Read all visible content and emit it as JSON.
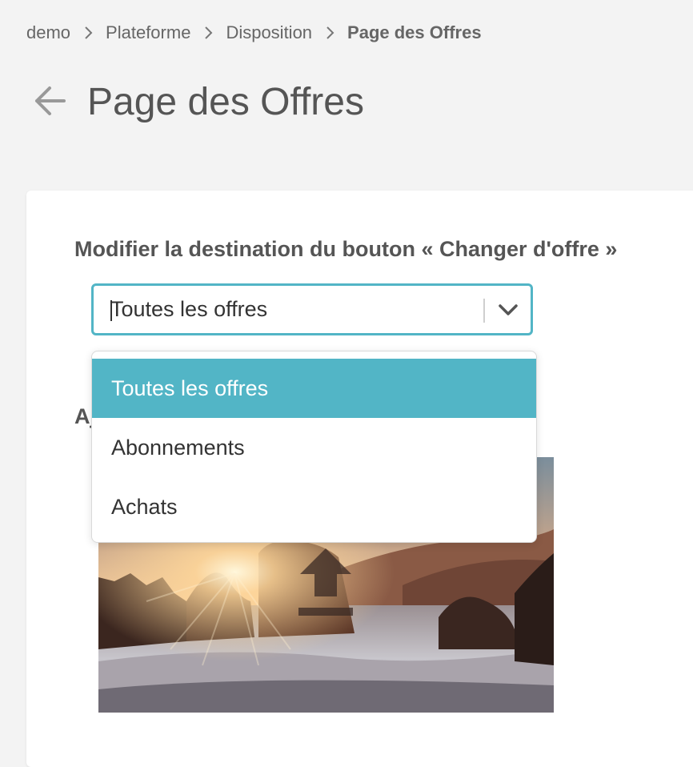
{
  "breadcrumb": {
    "items": [
      "demo",
      "Plateforme",
      "Disposition",
      "Page des Offres"
    ]
  },
  "page": {
    "title": "Page des Offres"
  },
  "form": {
    "destination_label": "Modifier la destination du bouton « Changer d'offre »",
    "destination_select": {
      "value": "Toutes les offres",
      "options": [
        "Toutes les offres",
        "Abonnements",
        "Achats"
      ],
      "selected_index": 0
    },
    "partially_hidden_label": "Aj"
  },
  "icons": {
    "back": "arrow-left-icon",
    "breadcrumb_separator": "chevron-right-icon",
    "select_toggle": "chevron-down-icon",
    "upload": "upload-icon"
  },
  "colors": {
    "accent": "#52b5c6",
    "background": "#f3f3f3",
    "card": "#ffffff",
    "text": "#555555"
  }
}
